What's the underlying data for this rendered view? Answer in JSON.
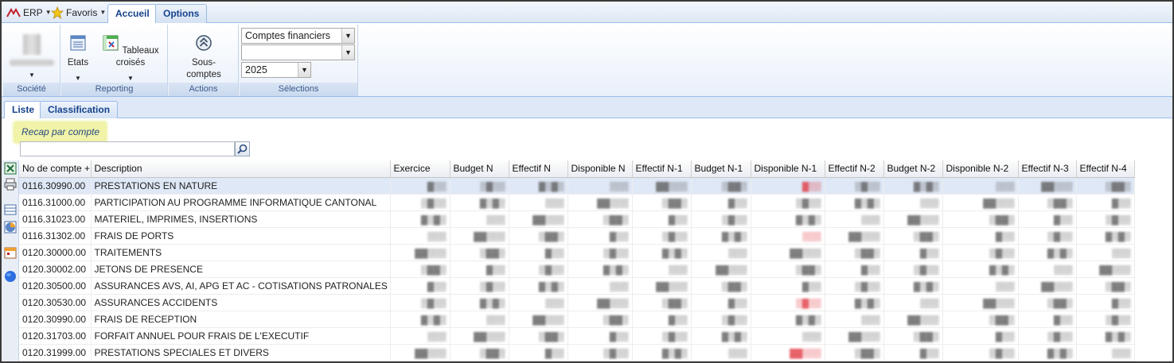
{
  "menubar": {
    "erp_label": "ERP",
    "favoris_label": "Favoris",
    "tabs": [
      "Accueil",
      "Options"
    ]
  },
  "ribbon": {
    "societe": {
      "label": "Société"
    },
    "reporting": {
      "label": "Reporting",
      "etats": "Etats",
      "tableaux": "Tableaux croisés"
    },
    "actions": {
      "label": "Actions",
      "sous_comptes_1": "Sous-",
      "sous_comptes_2": "comptes"
    },
    "selections": {
      "label": "Sélections",
      "select1": "Comptes financiers",
      "select2": "",
      "year": "2025"
    }
  },
  "subtabs": [
    "Liste",
    "Classification"
  ],
  "recap_label": "Recap par compte",
  "search": {
    "placeholder": ""
  },
  "grid": {
    "columns": [
      "No de compte +",
      "Description",
      "Exercice",
      "Budget N",
      "Effectif N",
      "Disponible N",
      "Effectif N-1",
      "Budget N-1",
      "Disponible N-1",
      "Effectif N-2",
      "Budget N-2",
      "Disponible N-2",
      "Effectif N-3",
      "Effectif N-4"
    ],
    "rows": [
      {
        "account": "0116.30990.00",
        "description": "PRESTATIONS EN NATURE",
        "neg": [
          8
        ]
      },
      {
        "account": "0116.31000.00",
        "description": "PARTICIPATION AU PROGRAMME INFORMATIQUE CANTONAL",
        "neg": []
      },
      {
        "account": "0116.31023.00",
        "description": "MATERIEL, IMPRIMES, INSERTIONS",
        "neg": []
      },
      {
        "account": "0116.31302.00",
        "description": "FRAIS DE PORTS",
        "neg": [
          8
        ]
      },
      {
        "account": "0120.30000.00",
        "description": "TRAITEMENTS",
        "neg": []
      },
      {
        "account": "0120.30002.00",
        "description": "JETONS DE PRESENCE",
        "neg": []
      },
      {
        "account": "0120.30500.00",
        "description": "ASSURANCES AVS, AI, APG ET AC - COTISATIONS PATRONALES",
        "neg": []
      },
      {
        "account": "0120.30530.00",
        "description": "ASSURANCES ACCIDENTS",
        "neg": [
          8
        ]
      },
      {
        "account": "0120.30990.00",
        "description": "FRAIS DE RECEPTION",
        "neg": []
      },
      {
        "account": "0120.31703.00",
        "description": "FORFAIT ANNUEL POUR FRAIS DE L'EXECUTIF",
        "neg": []
      },
      {
        "account": "0120.31999.00",
        "description": "PRESTATIONS SPECIALES ET DIVERS",
        "neg": [
          8
        ]
      }
    ]
  }
}
